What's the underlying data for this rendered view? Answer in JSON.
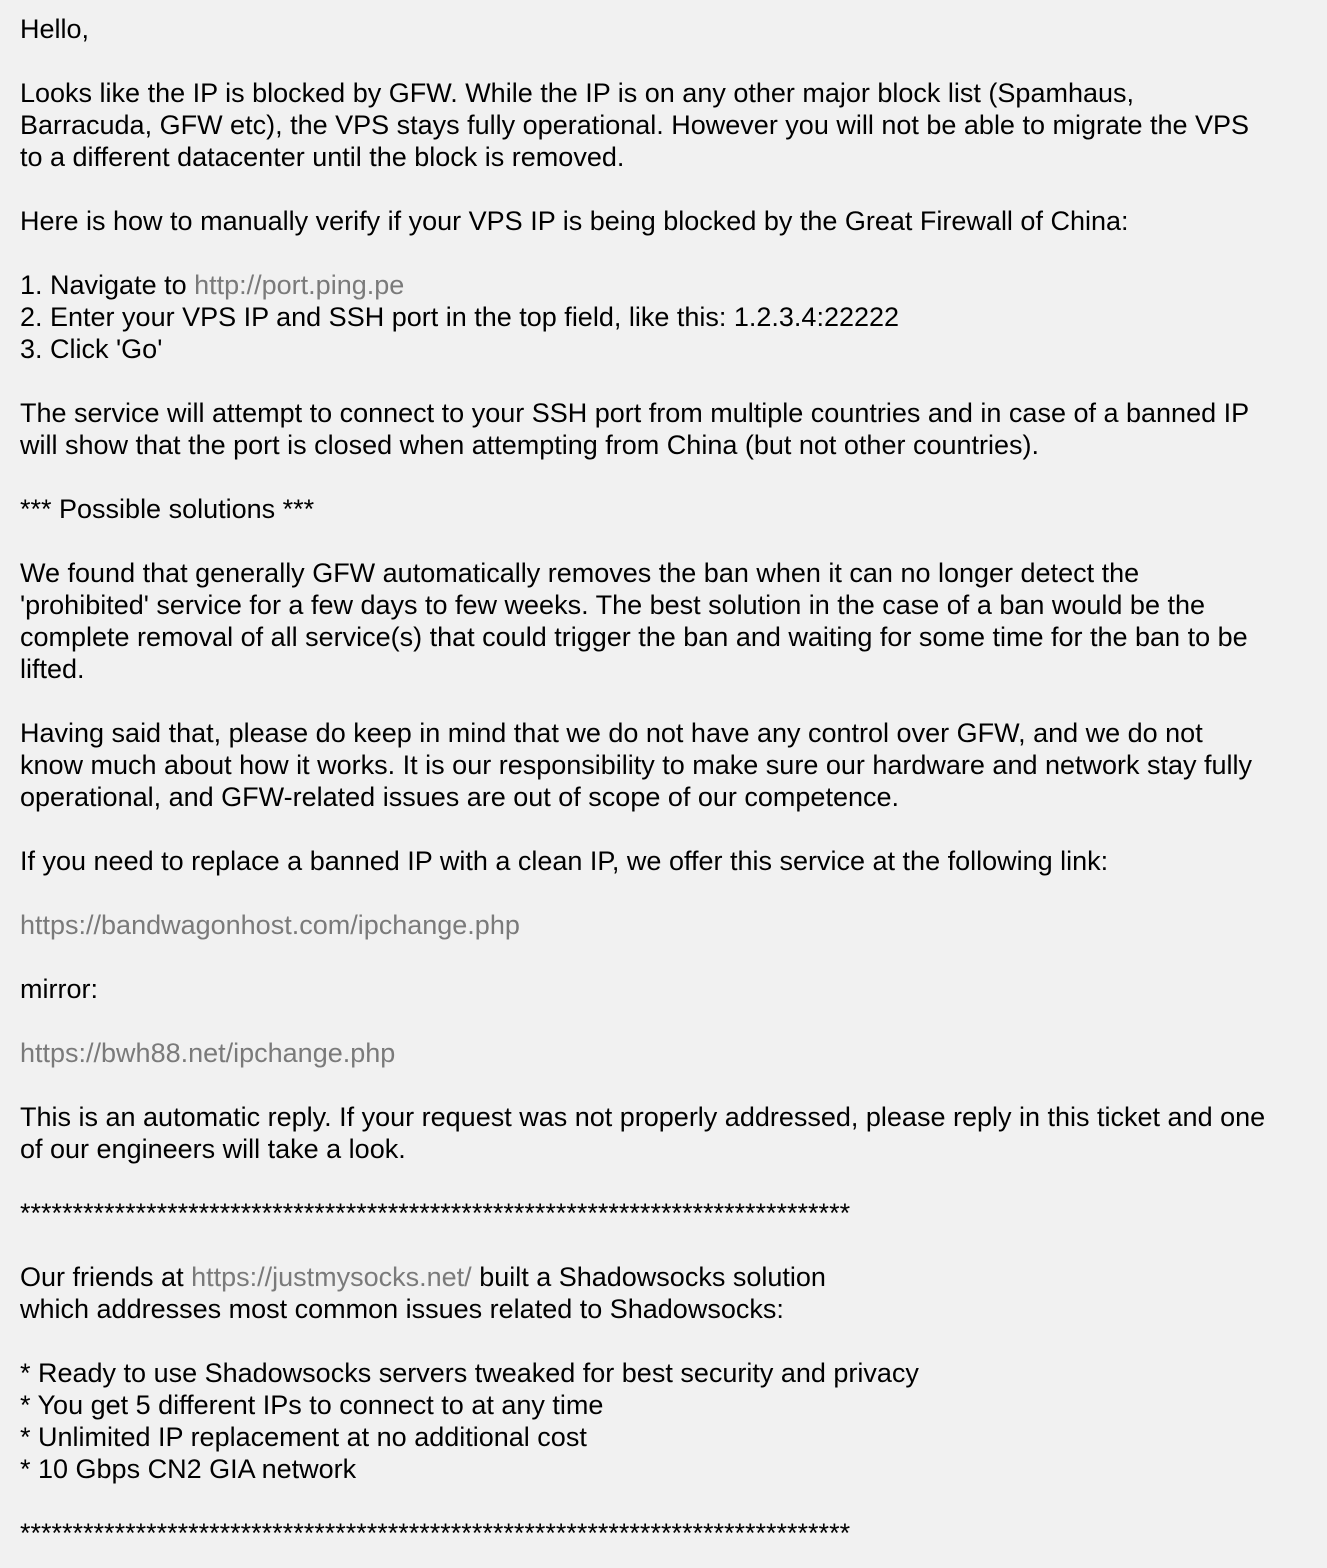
{
  "greeting": "Hello,",
  "intro": {
    "lines": [
      "Looks like the IP is blocked by GFW. While the IP is on any other major block list (Spamhaus,",
      "Barracuda, GFW etc), the VPS stays fully operational. However you will not be able to migrate the VPS",
      "to a different datacenter until the block is removed."
    ]
  },
  "verify_heading": "Here is how to manually verify if your VPS IP is being blocked by the Great Firewall of China:",
  "steps": {
    "step1_prefix": "1. Navigate to ",
    "step1_link": "http://port.ping.pe",
    "step2": "2. Enter your VPS IP and SSH port in the top field, like this: 1.2.3.4:22222",
    "step3": "3. Click 'Go'"
  },
  "service": {
    "lines": [
      "The service will attempt to connect to your SSH port from multiple countries and in case of a banned IP",
      "will show that the port is closed when attempting from China (but not other countries)."
    ]
  },
  "solutions_heading": "*** Possible solutions ***",
  "solutions": {
    "lines": [
      "We found that generally GFW automatically removes the ban when it can no longer detect the",
      "'prohibited' service for a few days to few weeks. The best solution in the case of a ban would be the",
      "complete removal of all service(s) that could trigger the ban and waiting for some time for the ban to be",
      "lifted."
    ]
  },
  "disclaimer": {
    "lines": [
      "Having said that, please do keep in mind that we do not have any control over GFW, and we do not",
      "know much about how it works. It is our responsibility to make sure our hardware and network stay fully",
      "operational, and GFW-related issues are out of scope of our competence."
    ]
  },
  "replace_text": "If you need to replace a banned IP with a clean IP, we offer this service at the following link:",
  "ipchange_link": "https://bandwagonhost.com/ipchange.php",
  "mirror_label": "mirror:",
  "mirror_link": "https://bwh88.net/ipchange.php",
  "auto_reply": {
    "lines": [
      "This is an automatic reply. If your request was not properly addressed, please reply in this ticket and one",
      "of our engineers will take a look."
    ]
  },
  "separator": "*******************************************************************************",
  "promo": {
    "prefix": "Our friends at ",
    "link": "https://justmysocks.net/",
    "suffix": " built a Shadowsocks solution",
    "line2": "which addresses most common issues related to Shadowsocks:"
  },
  "features": [
    "* Ready to use Shadowsocks servers tweaked for best security and privacy",
    "* You get 5 different IPs to connect to at any time",
    "* Unlimited IP replacement at no additional cost",
    "* 10 Gbps CN2 GIA network"
  ],
  "colors": {
    "background": "#f1f1f1",
    "text": "#000000",
    "link": "#7a7a7a"
  }
}
